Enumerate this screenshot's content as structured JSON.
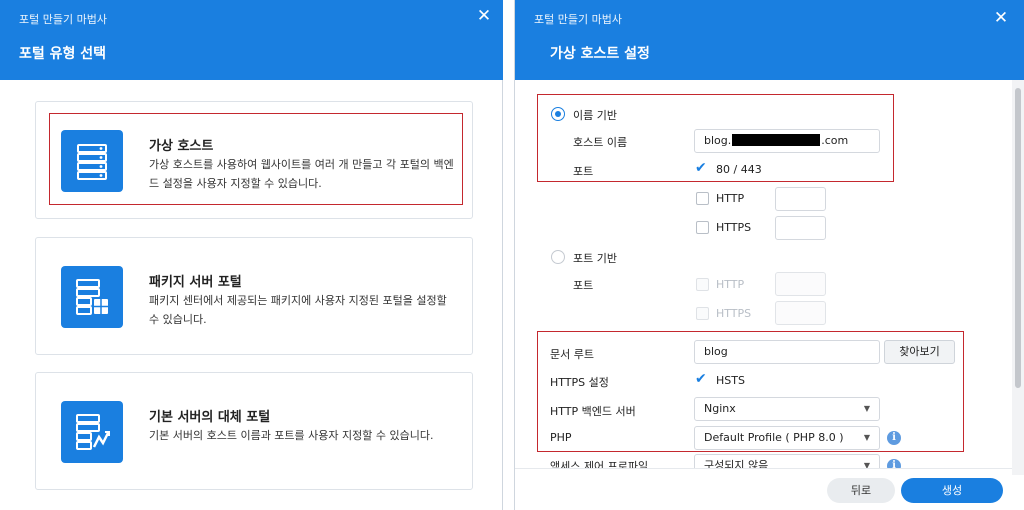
{
  "left_dialog": {
    "wizard_title": "포털 만들기 마법사",
    "close_glyph": "✕",
    "step_title": "포털 유형 선택",
    "options": [
      {
        "title": "가상 호스트",
        "description": "가상 호스트를 사용하여 웹사이트를 여러 개 만들고 각 포털의 백엔드 설정을 사용자 지정할 수 있습니다.",
        "icon": "server-stack-icon"
      },
      {
        "title": "패키지 서버 포털",
        "description": "패키지 센터에서 제공되는 패키지에 사용자 지정된 포털을 설정할 수 있습니다.",
        "icon": "package-server-icon"
      },
      {
        "title": "기본 서버의 대체 포털",
        "description": "기본 서버의 호스트 이름과 포트를 사용자 지정할 수 있습니다.",
        "icon": "default-server-alias-icon"
      }
    ]
  },
  "right_dialog": {
    "wizard_title": "포털 만들기 마법사",
    "close_glyph": "✕",
    "step_title": "가상 호스트 설정",
    "name_based": {
      "label": "이름 기반",
      "selected": true,
      "hostname_label": "호스트 이름",
      "hostname_prefix": "blog.",
      "hostname_suffix": ".com",
      "port_label": "포트",
      "port_default_label": "80 / 443",
      "port_default_checked": true,
      "http_label": "HTTP",
      "https_label": "HTTPS"
    },
    "port_based": {
      "label": "포트 기반",
      "selected": false,
      "port_label": "포트",
      "http_label": "HTTP",
      "https_label": "HTTPS"
    },
    "document_root_label": "문서 루트",
    "document_root_value": "blog",
    "browse_button": "찾아보기",
    "https_settings_label": "HTTPS 설정",
    "hsts_label": "HSTS",
    "hsts_checked": true,
    "backend_label": "HTTP 백엔드 서버",
    "backend_value": "Nginx",
    "php_label": "PHP",
    "php_value": "Default Profile ( PHP 8.0 )",
    "acl_label": "액세스 제어 프로파일",
    "acl_value": "구성되지 않음",
    "back_button": "뒤로",
    "create_button": "생성",
    "accent_color": "#1a7fe0",
    "highlight_color": "#c4282e"
  }
}
